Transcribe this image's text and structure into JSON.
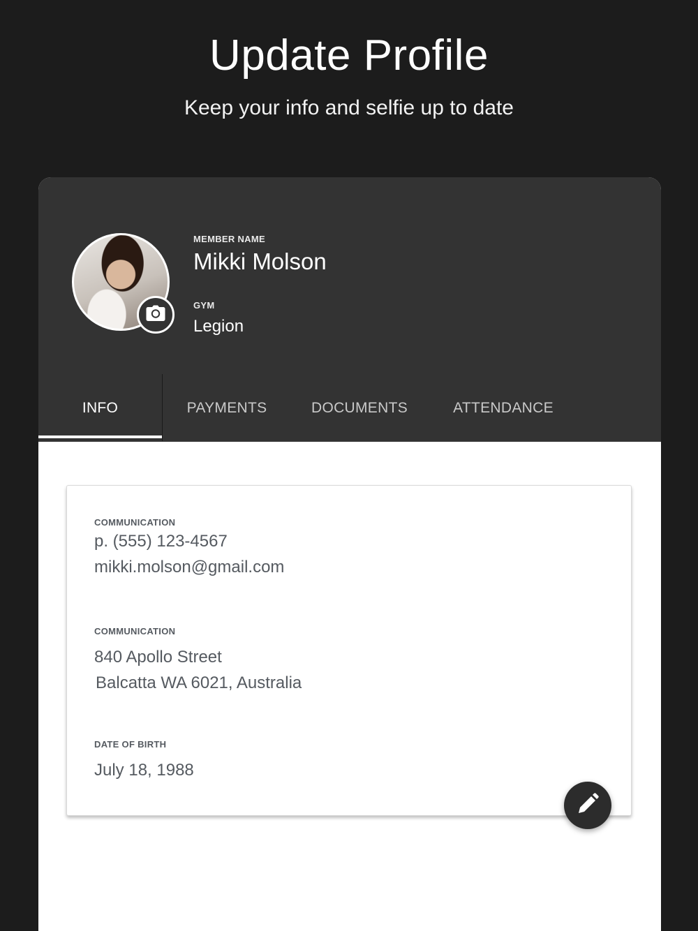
{
  "header": {
    "title": "Update Profile",
    "subtitle": "Keep your info and selfie up to date"
  },
  "profile": {
    "member_name_label": "MEMBER NAME",
    "member_name": "Mikki Molson",
    "gym_label": "GYM",
    "gym": "Legion",
    "avatar_icon": "camera-icon"
  },
  "tabs": [
    {
      "label": "INFO",
      "active": true
    },
    {
      "label": "PAYMENTS",
      "active": false
    },
    {
      "label": "DOCUMENTS",
      "active": false
    },
    {
      "label": "ATTENDANCE",
      "active": false
    }
  ],
  "info": {
    "communication_label": "COMMUNICATION",
    "phone": "p. (555) 123-4567",
    "email": "mikki.molson@gmail.com",
    "address_label": "COMMUNICATION",
    "address_line1": "840 Apollo Street",
    "address_line2": "Balcatta WA 6021, Australia",
    "dob_label": "DATE OF BIRTH",
    "dob": "July 18, 1988"
  },
  "actions": {
    "edit_icon": "pencil-icon"
  },
  "colors": {
    "background": "#1c1c1c",
    "header_panel": "#333333",
    "content": "#ffffff",
    "text_muted": "#555a60"
  }
}
